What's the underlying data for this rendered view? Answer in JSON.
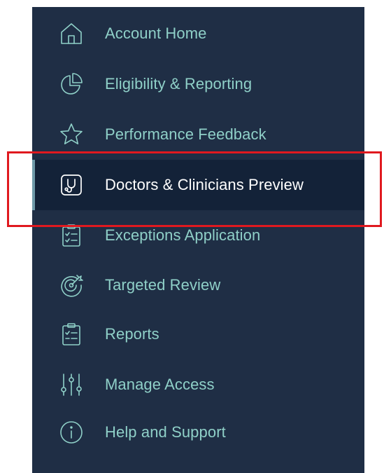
{
  "colors": {
    "sidebar_bg": "#1f2e45",
    "active_bg": "#132238",
    "active_indicator": "#6f9aa9",
    "label": "#8fd0c8",
    "active_label": "#ffffff",
    "icon": "#8fd0c8",
    "highlight_border": "#e0191f"
  },
  "sidebar": {
    "items": [
      {
        "label": "Account Home",
        "icon": "home-icon"
      },
      {
        "label": "Eligibility & Reporting",
        "icon": "pie-chart-icon"
      },
      {
        "label": "Performance Feedback",
        "icon": "star-icon"
      },
      {
        "label": "Doctors & Clinicians Preview",
        "icon": "stethoscope-icon",
        "active": true
      },
      {
        "label": "Exceptions Application",
        "icon": "clipboard-checklist-icon"
      },
      {
        "label": "Targeted Review",
        "icon": "target-icon"
      },
      {
        "label": "Reports",
        "icon": "clipboard-report-icon"
      },
      {
        "label": "Manage Access",
        "icon": "sliders-icon"
      },
      {
        "label": "Help and Support",
        "icon": "info-icon"
      }
    ]
  }
}
